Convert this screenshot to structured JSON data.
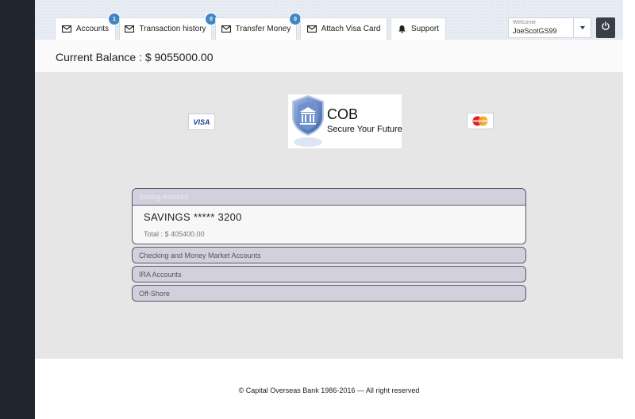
{
  "nav": {
    "tabs": [
      {
        "label": "Accounts",
        "badge": "1",
        "icon": "envelope-icon"
      },
      {
        "label": "Transaction history",
        "badge": "0",
        "icon": "envelope-icon"
      },
      {
        "label": "Transfer Money",
        "badge": "0",
        "icon": "envelope-icon"
      },
      {
        "label": "Attach Visa Card",
        "icon": "envelope-icon"
      },
      {
        "label": "Support",
        "icon": "bell-icon"
      }
    ],
    "welcome_label": "Welcome",
    "username": "JoeScotGS99"
  },
  "balance": {
    "text": "Current Balance : $ 9055000.00"
  },
  "brand": {
    "visa_text": "VISA",
    "logo_title": "COB",
    "logo_tagline": "Secure Your Future"
  },
  "accounts": {
    "sections": [
      {
        "label": "Saving Account",
        "expanded": true
      },
      {
        "label": "Checking and Money Market Accounts",
        "expanded": false
      },
      {
        "label": "IRA Accounts",
        "expanded": false
      },
      {
        "label": "Off-Shore",
        "expanded": false
      }
    ],
    "saving_account": {
      "name": "SAVINGS ***** 3200",
      "total": "Total : $ 405400.00"
    }
  },
  "footer": {
    "text": "© Capital Overseas Bank 1986-2016 — All right reserved"
  },
  "colors": {
    "badge": "#3f85c8",
    "accordion_header": "#d3d0de",
    "power_button": "#3b3f47"
  }
}
